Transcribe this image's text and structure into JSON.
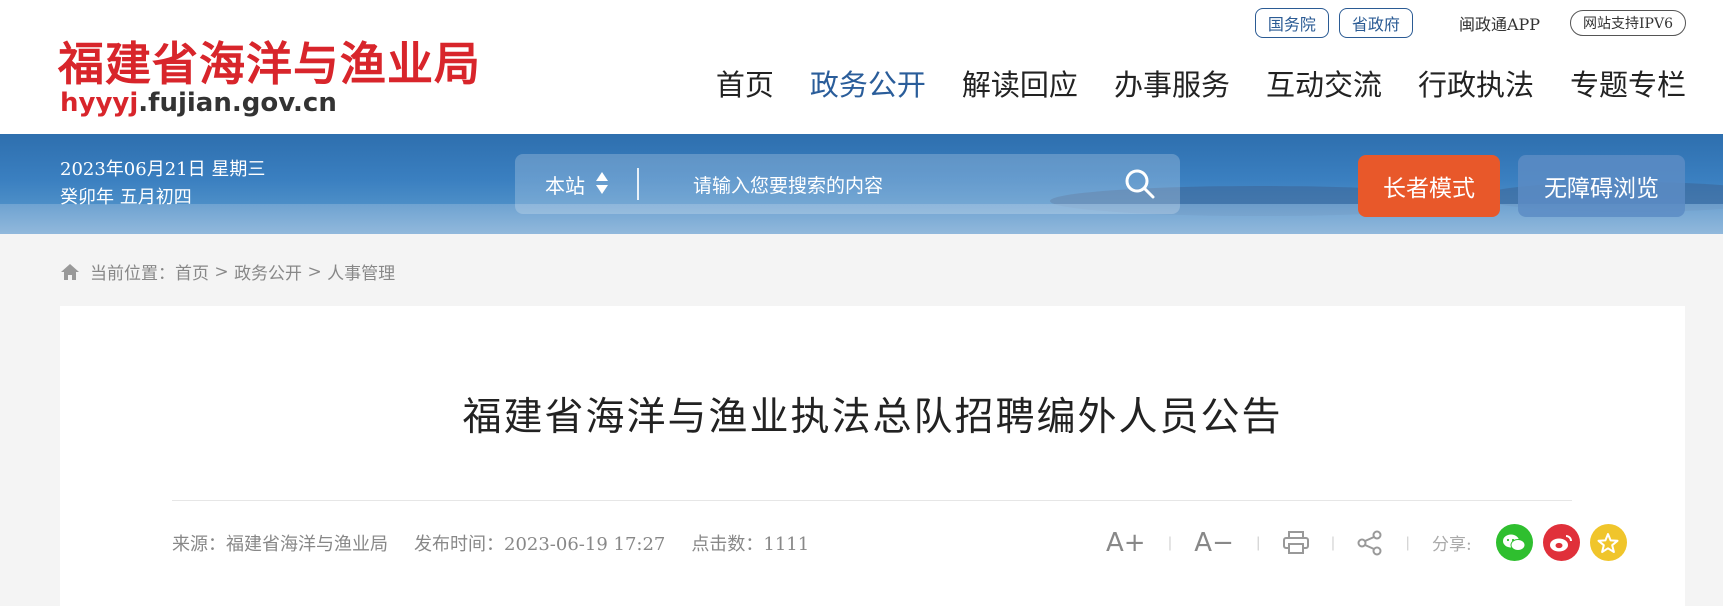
{
  "header": {
    "site_title": "福建省海洋与渔业局",
    "domain_highlight": "hyyyj",
    "domain_rest": ".fujian.gov.cn",
    "toplinks": [
      "国务院",
      "省政府"
    ],
    "app_link": "闽政通APP",
    "ipv6_badge": "网站支持IPV6",
    "nav": [
      {
        "label": "首页",
        "active": false
      },
      {
        "label": "政务公开",
        "active": true
      },
      {
        "label": "解读回应",
        "active": false
      },
      {
        "label": "办事服务",
        "active": false
      },
      {
        "label": "互动交流",
        "active": false
      },
      {
        "label": "行政执法",
        "active": false
      },
      {
        "label": "专题专栏",
        "active": false
      }
    ]
  },
  "banner": {
    "date_line1": "2023年06月21日 星期三",
    "date_line2": "癸卯年 五月初四",
    "search_scope": "本站",
    "search_placeholder": "请输入您要搜索的内容",
    "elder_mode_label": "长者模式",
    "accessibility_label": "无障碍浏览"
  },
  "breadcrumb": {
    "prefix": "当前位置：",
    "items": [
      "首页",
      "政务公开",
      "人事管理"
    ],
    "separator": " > "
  },
  "article": {
    "title": "福建省海洋与渔业执法总队招聘编外人员公告",
    "source": "来源：福建省海洋与渔业局",
    "publish_time": "发布时间：2023-06-19 17:27",
    "clicks": "点击数：1111",
    "font_increase": "A+",
    "font_decrease": "A−",
    "share_label": "分享:"
  },
  "colors": {
    "brand_red": "#d8252b",
    "nav_active": "#2a5d9a",
    "elder_button": "#e8582a",
    "wechat": "#2fbf2f",
    "weibo": "#e0303a",
    "favorite": "#f0c52b"
  }
}
